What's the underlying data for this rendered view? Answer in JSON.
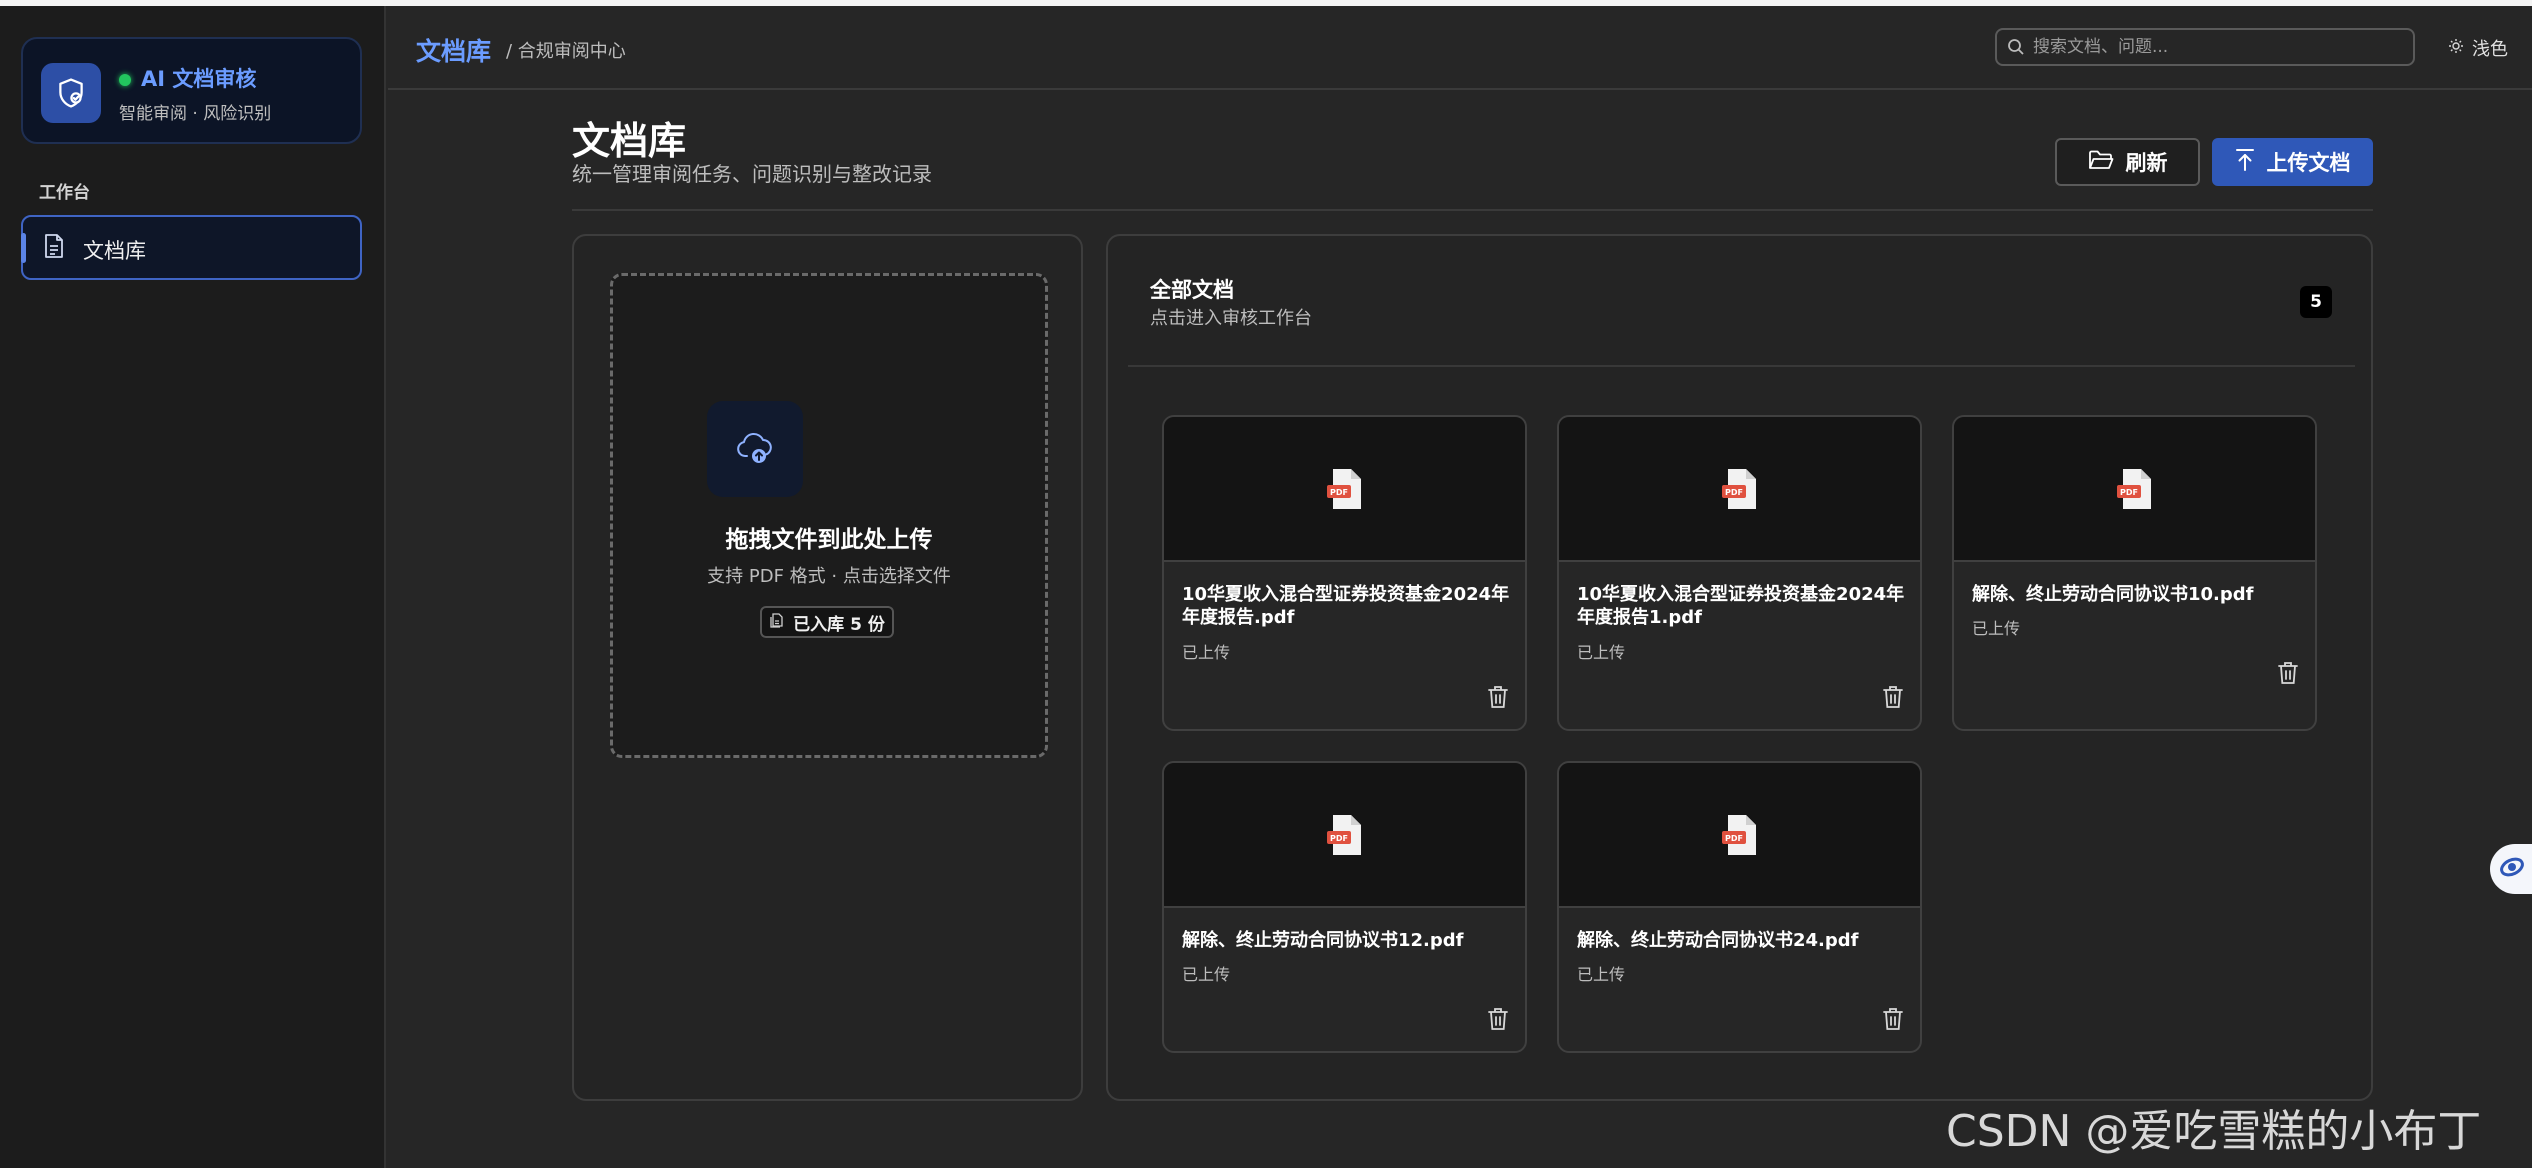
{
  "brand": {
    "title": "AI 文档审核",
    "subtitle": "智能审阅 · 风险识别"
  },
  "sidebar": {
    "section_label": "工作台",
    "items": [
      {
        "label": "文档库",
        "active": true
      }
    ]
  },
  "header": {
    "breadcrumb_main": "文档库",
    "breadcrumb_sub": "/ 合规审阅中心",
    "search_placeholder": "搜索文档、问题...",
    "theme_label": "浅色"
  },
  "page": {
    "title": "文档库",
    "subtitle": "统一管理审阅任务、问题识别与整改记录",
    "refresh_label": "刷新",
    "upload_label": "上传文档"
  },
  "upload_panel": {
    "title": "拖拽文件到此处上传",
    "subtitle": "支持 PDF 格式 · 点击选择文件",
    "badge": "已入库 5 份"
  },
  "docs_panel": {
    "title": "全部文档",
    "subtitle": "点击进入审核工作台",
    "count": "5",
    "documents": [
      {
        "name": "10华夏收入混合型证券投资基金2024年年度报告.pdf",
        "status": "已上传",
        "thumb_label": "PDF"
      },
      {
        "name": "10华夏收入混合型证券投资基金2024年年度报告1.pdf",
        "status": "已上传",
        "thumb_label": "PDF"
      },
      {
        "name": "解除、终止劳动合同协议书10.pdf",
        "status": "已上传",
        "thumb_label": "PDF"
      },
      {
        "name": "解除、终止劳动合同协议书12.pdf",
        "status": "已上传",
        "thumb_label": "PDF"
      },
      {
        "name": "解除、终止劳动合同协议书24.pdf",
        "status": "已上传",
        "thumb_label": "PDF"
      }
    ]
  },
  "watermark": "CSDN @爱吃雪糕的小布丁",
  "colors": {
    "accent": "#2f58b8",
    "accent_text": "#6b9cff",
    "status_dot": "#22c55e",
    "pdf_red": "#e0513f"
  }
}
